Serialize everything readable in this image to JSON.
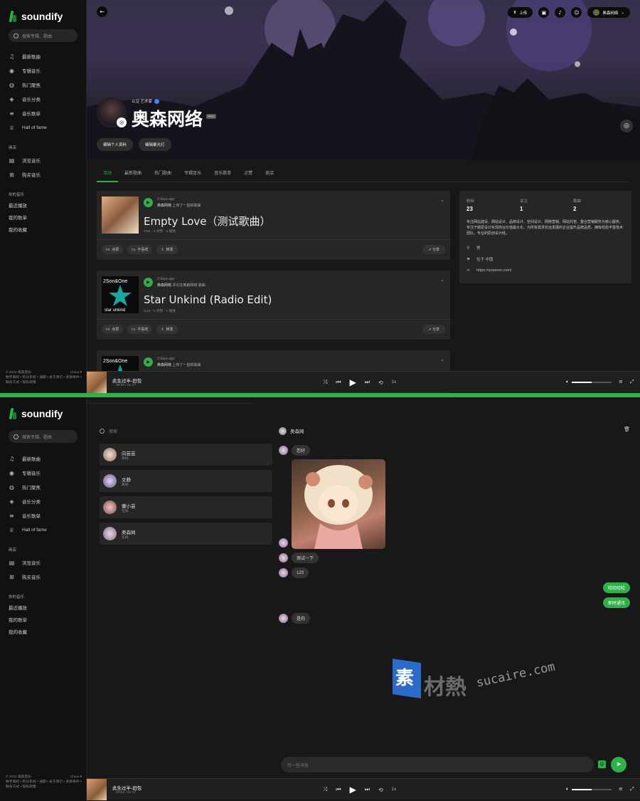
{
  "brand": {
    "name": "soundify"
  },
  "search": {
    "placeholder": "搜索专辑、歌曲"
  },
  "nav": [
    {
      "icon": "music-note-icon",
      "label": "最新歌曲"
    },
    {
      "icon": "disc-icon",
      "label": "专辑音乐"
    },
    {
      "icon": "fire-icon",
      "label": "热门聚焦"
    },
    {
      "icon": "layers-icon",
      "label": "音乐分类"
    },
    {
      "icon": "playlist-icon",
      "label": "音乐歌单"
    },
    {
      "icon": "trophy-icon",
      "label": "Hall of fame"
    }
  ],
  "store": {
    "title": "商店",
    "items": [
      {
        "icon": "browse-icon",
        "label": "浏览音乐"
      },
      {
        "icon": "cart-icon",
        "label": "购买音乐"
      }
    ]
  },
  "mymusic": {
    "title": "你的音乐",
    "items": [
      "最近播放",
      "我的歌单",
      "我的收藏"
    ]
  },
  "footer": {
    "copyright": "© 2022 奥森音乐",
    "region": "China ▾",
    "links": "数字版权 • 积分系统 • 通期 • 关于我们 • 条款条件 • 联系方式 • 隐私政策"
  },
  "header": {
    "upload": "上传",
    "user": "奥森网络"
  },
  "profile": {
    "verified": "认证 艺术家",
    "name": "奥森网络",
    "badge": "PRO",
    "edit_profile": "编辑个人资料",
    "edit_cover": "编辑聚光灯"
  },
  "tabs": [
    "活动",
    "最新歌曲",
    "热门歌曲",
    "专辑音乐",
    "音乐歌单",
    "点赞",
    "商店"
  ],
  "posts": [
    {
      "ago": "3 days ago",
      "author": "奥森网络",
      "action": " 上传了一首新歌曲",
      "title": "Empty Love（测试歌曲）",
      "meta": "2:50 · 4 点赞 · 2 播放"
    },
    {
      "ago": "3 days ago",
      "author": "奥森网络",
      "action": " 评论在奥森网络 歌曲",
      "title": "Star Unkind (Radio Edit)",
      "meta": "3:24 · 6 点赞 · 1 播放"
    },
    {
      "ago": "3 days ago",
      "author": "奥森网络",
      "action": " 上传了一首新歌曲",
      "title": "",
      "meta": ""
    }
  ],
  "post_actions": {
    "like": "点赞",
    "dislike": "不喜欢",
    "repost": "转发",
    "share": "分享"
  },
  "stats": [
    {
      "label": "粉丝",
      "value": "23"
    },
    {
      "label": "关注",
      "value": "1"
    },
    {
      "label": "歌曲",
      "value": "2"
    }
  ],
  "bio": "专注网站建设、网站设计、品牌设计、空间设计、网络营销、网站托管、整合营销服务为核心服务。专注于做原设计实现商业价值最大化，为所有需求长远发展的企业提升品牌品质。拥有经验丰富技术团队，专业的原创设计经。",
  "info": {
    "gender": "男",
    "location": "位于 中国",
    "website": "https://aosenm.com/"
  },
  "player": {
    "song": "此生过半-旧包",
    "time1": "00:00 / 01:17",
    "time2": "00:02 / 01:17",
    "speed": "1x",
    "volume": 0.5
  },
  "chat": {
    "search_placeholder": "搜索",
    "contacts": [
      {
        "name": "向芸芸",
        "status": "离线"
      },
      {
        "name": "文静",
        "status": "离线"
      },
      {
        "name": "蕾小芸",
        "status": "在线"
      },
      {
        "name": "奥森网",
        "status": "在线"
      }
    ],
    "active": "奥森网",
    "messages": [
      {
        "from": "them",
        "text": "您好"
      },
      {
        "from": "them",
        "text": "测试一下"
      },
      {
        "from": "them",
        "text": "123"
      },
      {
        "from": "me",
        "text": "哈哈哈哈"
      },
      {
        "from": "me",
        "text": "即时通讯"
      },
      {
        "from": "them",
        "text": "是的"
      }
    ],
    "input_placeholder": "写一些消息"
  },
  "watermark": {
    "text": "素材熱",
    "url": "sucaire.com"
  },
  "colors": {
    "accent": "#2fb14a",
    "bg": "#181818",
    "sidebar": "#111111",
    "card": "#262626"
  }
}
